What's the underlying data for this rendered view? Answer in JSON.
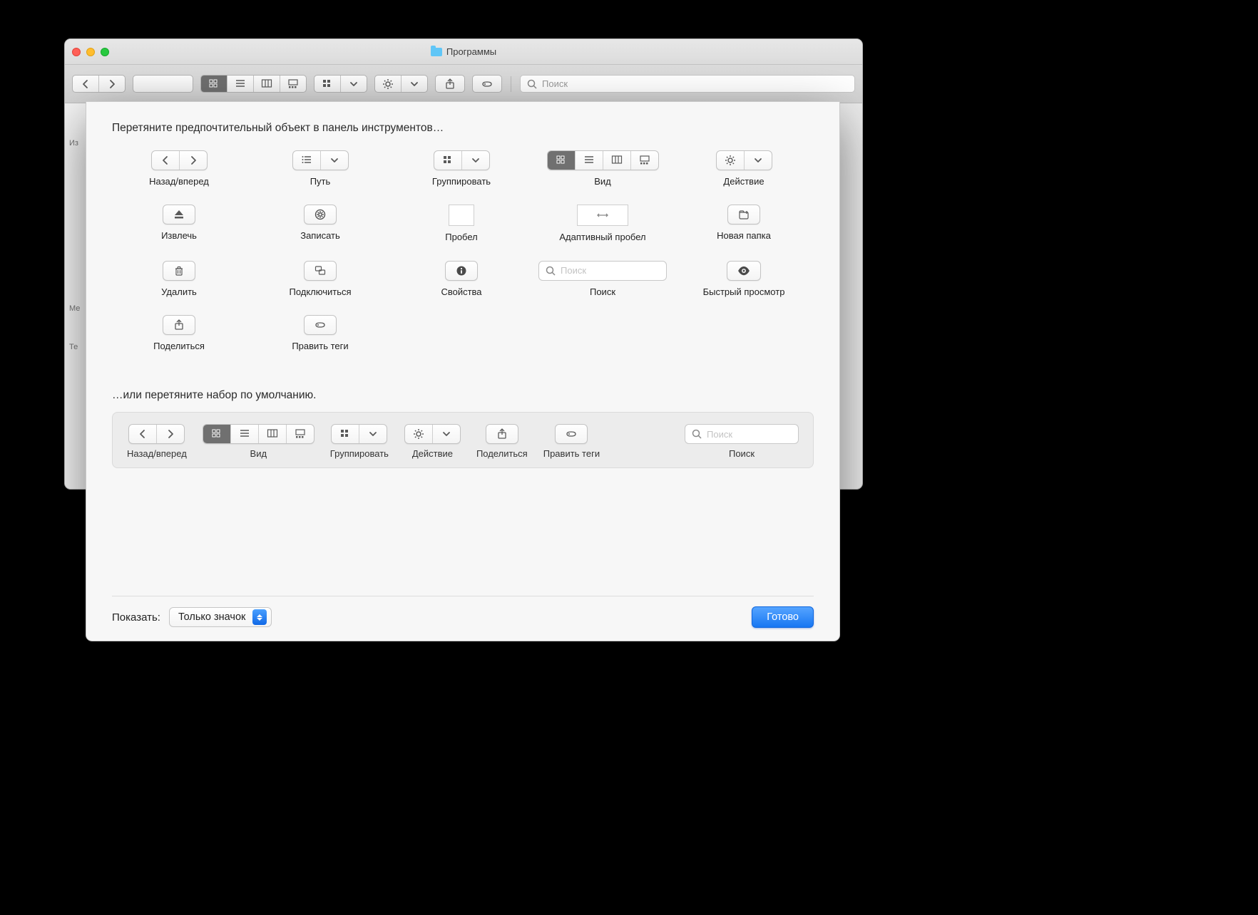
{
  "window": {
    "title": "Программы"
  },
  "toolbar": {
    "search_placeholder": "Поиск"
  },
  "sidebar": {
    "h1": "Из",
    "h2": "Ме",
    "h3": "Те"
  },
  "sheet": {
    "heading": "Перетяните предпочтительный объект в панель инструментов…",
    "items": {
      "back_forward": "Назад/вперед",
      "path": "Путь",
      "group": "Группировать",
      "view": "Вид",
      "action": "Действие",
      "eject": "Извлечь",
      "burn": "Записать",
      "space": "Пробел",
      "flex_space": "Адаптивный пробел",
      "new_folder": "Новая папка",
      "delete": "Удалить",
      "connect": "Подключиться",
      "info": "Свойства",
      "search": "Поиск",
      "search_placeholder": "Поиск",
      "quicklook": "Быстрый просмотр",
      "share": "Поделиться",
      "tags": "Править теги"
    },
    "or_line": "…или перетяните набор по умолчанию.",
    "default": {
      "back_forward": "Назад/вперед",
      "view": "Вид",
      "group": "Группировать",
      "action": "Действие",
      "share": "Поделиться",
      "tags": "Править теги",
      "search": "Поиск",
      "search_placeholder": "Поиск"
    },
    "footer": {
      "show_label": "Показать:",
      "show_value": "Только значок",
      "done": "Готово"
    }
  }
}
